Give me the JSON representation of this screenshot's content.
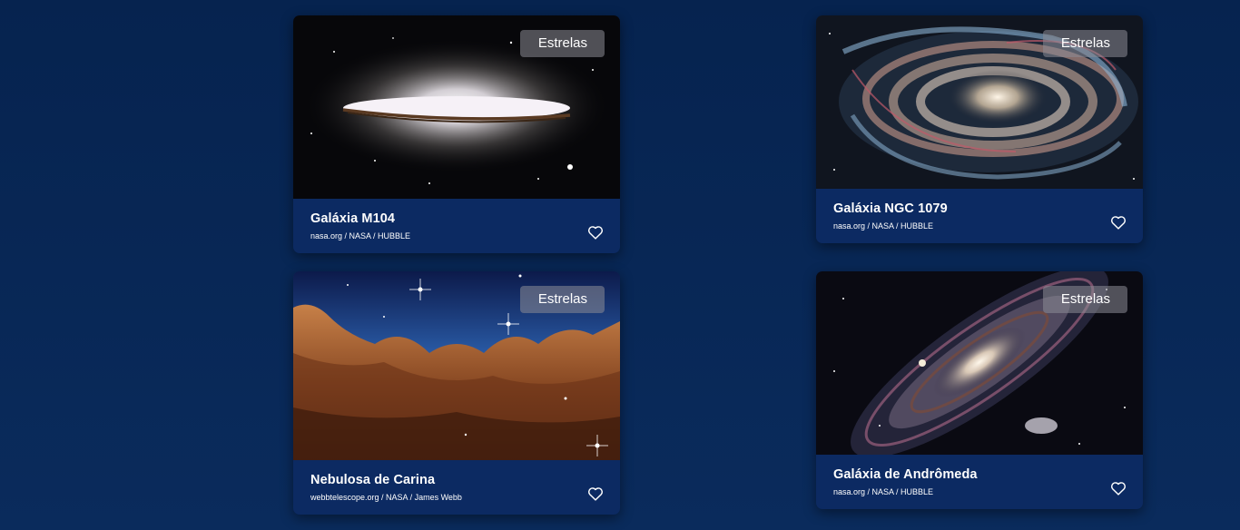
{
  "cards": [
    {
      "title": "Galáxia M104",
      "source": "nasa.org / NASA / HUBBLE",
      "tag": "Estrelas",
      "image": "sombrero-galaxy-image",
      "favorite_icon": "heart-icon"
    },
    {
      "title": "Galáxia NGC 1079",
      "source": "nasa.org / NASA / HUBBLE",
      "tag": "Estrelas",
      "image": "spiral-galaxy-image",
      "favorite_icon": "heart-icon"
    },
    {
      "title": "Nebulosa de Carina",
      "source": "webbtelescope.org / NASA / James Webb",
      "tag": "Estrelas",
      "image": "carina-nebula-image",
      "favorite_icon": "heart-icon"
    },
    {
      "title": "Galáxia de Andrômeda",
      "source": "nasa.org / NASA / HUBBLE",
      "tag": "Estrelas",
      "image": "andromeda-galaxy-image",
      "favorite_icon": "heart-icon"
    }
  ],
  "colors": {
    "background": "#06234f",
    "card_footer": "#0c2a62",
    "text": "#ffffff"
  }
}
